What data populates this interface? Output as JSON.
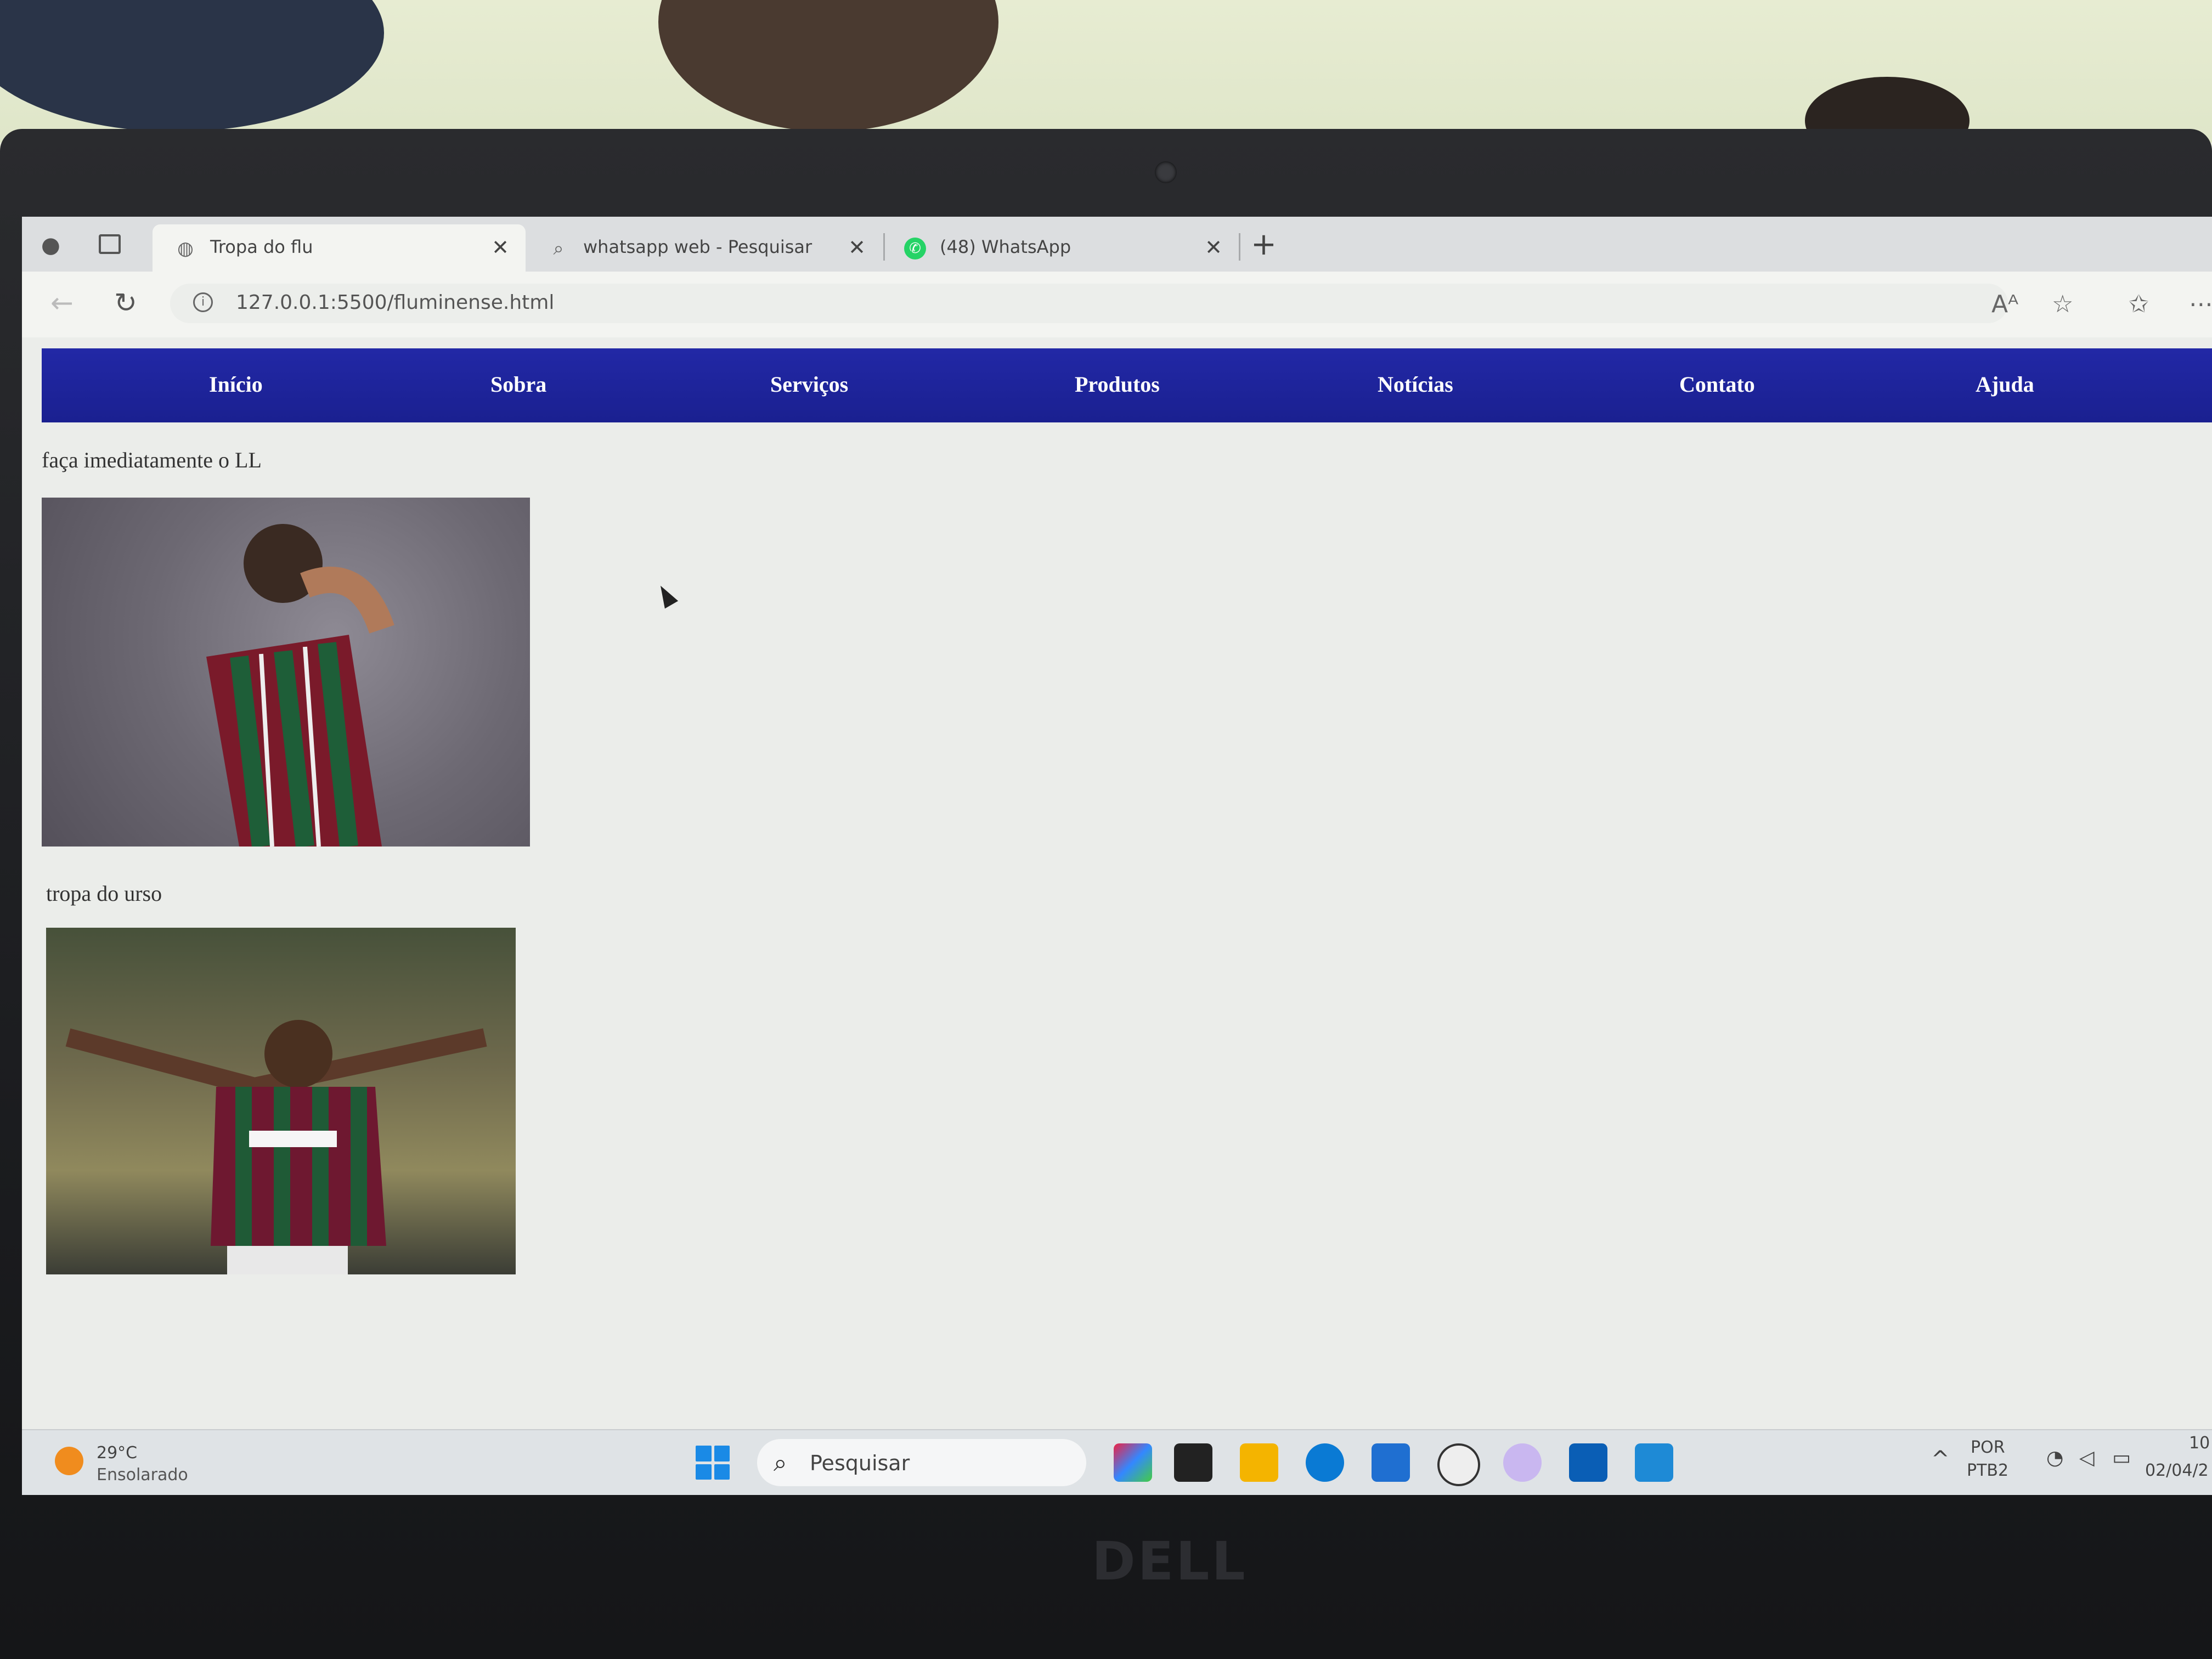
{
  "browser": {
    "tabs": [
      {
        "title": "Tropa do flu",
        "active": true,
        "icon": "globe-icon"
      },
      {
        "title": "whatsapp web - Pesquisar",
        "active": false,
        "icon": "search-icon"
      },
      {
        "title": "(48) WhatsApp",
        "active": false,
        "icon": "whatsapp-icon"
      }
    ],
    "close_glyph": "✕",
    "new_tab_glyph": "+",
    "url": "127.0.0.1:5500/fluminense.html"
  },
  "page": {
    "nav_items": [
      "Início",
      "Sobra",
      "Serviços",
      "Produtos",
      "Notícias",
      "Contato",
      "Ajuda"
    ],
    "nav_color": "#1f26a0",
    "caption1": "faça imediatamente o LL",
    "caption2": "tropa do urso"
  },
  "taskbar": {
    "weather_temp": "29°C",
    "weather_desc": "Ensolarado",
    "search_label": "Pesquisar",
    "lang_line1": "POR",
    "lang_line2": "PTB2",
    "date_partial": "02/04/2",
    "time_partial": "10"
  }
}
